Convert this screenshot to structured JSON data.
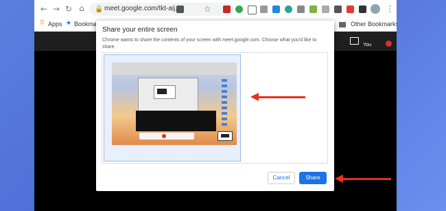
{
  "browser": {
    "url": "meet.google.com/tkt-aij...",
    "nav": {
      "back": "←",
      "forward": "→",
      "reload": "↻",
      "lock": "🔒",
      "star": "☆"
    },
    "bookmarks": {
      "apps": "Apps",
      "bookmark1": "Bookmark",
      "other": "Other Bookmarks"
    }
  },
  "meet": {
    "you_label": "You"
  },
  "dialog": {
    "title": "Share your entire screen",
    "message": "Chrome wants to share the contents of your screen with meet.google.com. Choose what you'd like to share.",
    "cancel_label": "Cancel",
    "share_label": "Share"
  },
  "colors": {
    "accent": "#1a73e8",
    "arrow": "#e8301c"
  }
}
